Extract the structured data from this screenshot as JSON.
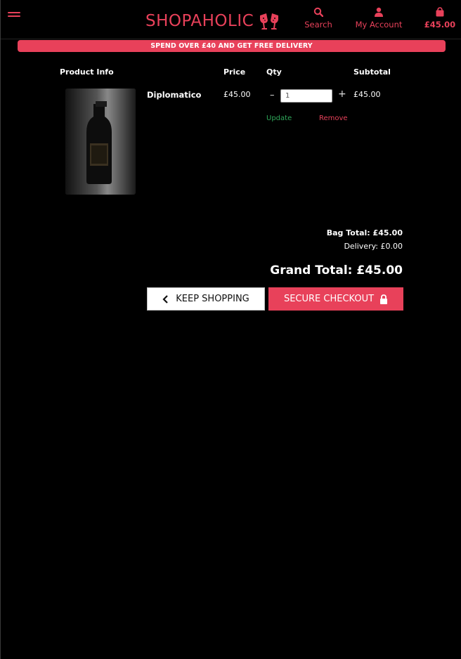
{
  "header": {
    "logo_text": "SHOPAHOLIC",
    "search_label": "Search",
    "account_label": "My Account",
    "cart_total": "£45.00"
  },
  "promo": {
    "text": "SPEND OVER £40 AND GET FREE DELIVERY"
  },
  "table": {
    "columns": [
      "Product Info",
      "Price",
      "Qty",
      "Subtotal"
    ],
    "items": [
      {
        "name": "Diplomatico",
        "price": "£45.00",
        "qty": "1",
        "subtotal": "£45.00",
        "update_label": "Update",
        "remove_label": "Remove"
      }
    ]
  },
  "totals": {
    "bag_total": "Bag Total: £45.00",
    "delivery": "Delivery: £0.00",
    "grand_total": "Grand Total: £45.00"
  },
  "actions": {
    "keep_shopping": "KEEP SHOPPING",
    "secure_checkout": "SECURE CHECKOUT"
  },
  "colors": {
    "accent": "#e8415a",
    "update": "#2fa85a",
    "background": "#000000"
  },
  "icons": [
    "menu-icon",
    "champagne-glasses-icon",
    "search-icon",
    "user-icon",
    "bag-icon",
    "chevron-left-icon",
    "lock-icon"
  ]
}
